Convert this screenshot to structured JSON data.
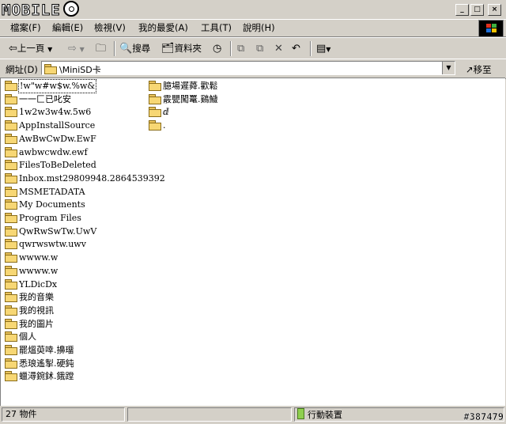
{
  "window": {
    "logo": "MOBILE",
    "controls": [
      "_",
      "□",
      "×"
    ]
  },
  "menu": [
    "檔案(F)",
    "編輯(E)",
    "檢視(V)",
    "我的最愛(A)",
    "工具(T)",
    "說明(H)"
  ],
  "toolbar": {
    "back_label": "上一頁",
    "search_label": "搜尋",
    "folders_label": "資料夾"
  },
  "address": {
    "label": "網址(D)",
    "value": "\\MiniSD卡",
    "go_label": "移至"
  },
  "files_col1": [
    "!w\"w#w$w.%w&",
    "一一匚已叱安",
    "1w2w3w4w.5w6",
    "AppInstallSource",
    "AwBwCwDw.EwF",
    "awbwcwdw.ewf",
    "FilesToBeDeleted",
    "Inbox.mst29809948.2864539392",
    "MSMETADATA",
    "My Documents",
    "Program Files",
    "QwRwSwTw.UwV",
    "qwrwswtw.uwv",
    "    wwww.w",
    "wwww.w",
    "YLDicDx",
    "我的音樂",
    "我的視訊",
    "我的圖片",
    "個人",
    "罷熅萸啈.擤璢",
    "悉琅遙掣.硬鈍",
    "蠟潯鋺鉥.鋨蹚"
  ],
  "files_col2": [
    "臆場遲蕣.歡鬆",
    "霰甖闖鼍.鷄鱥",
    "          ⅆ",
    "          ."
  ],
  "status": {
    "count": "27 物件",
    "location": "行動裝置",
    "watermark": "#387479"
  }
}
